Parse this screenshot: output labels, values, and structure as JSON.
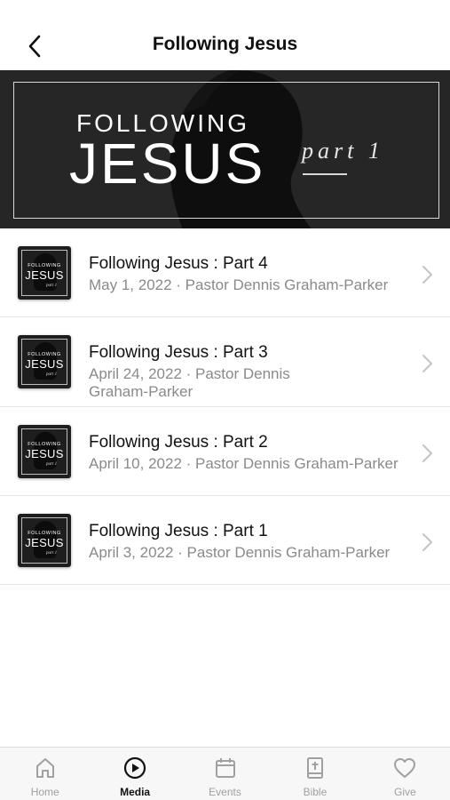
{
  "header": {
    "title": "Following Jesus",
    "back_icon": "chevron-left-icon"
  },
  "banner": {
    "line1": "FOLLOWING",
    "line2": "JESUS",
    "part": "part 1"
  },
  "thumbnail": {
    "line1": "FOLLOWING",
    "line2": "JESUS",
    "line3": "part 1"
  },
  "items": [
    {
      "title": "Following Jesus : Part 4",
      "meta": "May 1, 2022 · Pastor Dennis Graham-Parker"
    },
    {
      "title": "Following Jesus : Part 3",
      "meta": "April 24, 2022 · Pastor Dennis Graham-Parker"
    },
    {
      "title": "Following Jesus : Part 2",
      "meta": "April 10, 2022 · Pastor Dennis Graham-Parker"
    },
    {
      "title": "Following Jesus : Part 1",
      "meta": "April 3, 2022 · Pastor Dennis Graham-Parker"
    }
  ],
  "tabs": [
    {
      "label": "Home",
      "icon": "home-icon",
      "active": false
    },
    {
      "label": "Media",
      "icon": "play-circle-icon",
      "active": true
    },
    {
      "label": "Events",
      "icon": "calendar-icon",
      "active": false
    },
    {
      "label": "Bible",
      "icon": "bible-icon",
      "active": false
    },
    {
      "label": "Give",
      "icon": "heart-icon",
      "active": false
    }
  ],
  "colors": {
    "banner_bg": "#262626",
    "active_tab": "#111111",
    "inactive_tab": "#a0a0a0",
    "meta_text": "#8a8a8a"
  }
}
